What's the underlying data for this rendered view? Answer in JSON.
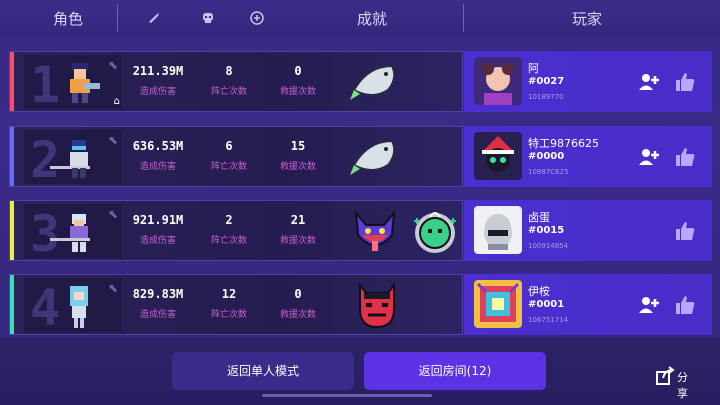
{
  "header": {
    "role": "角色",
    "achievement": "成就",
    "player": "玩家"
  },
  "rows": [
    {
      "rank": "1",
      "damage": "211.39M",
      "deaths": "8",
      "rescues": "0",
      "player": {
        "name": "阿",
        "tag": "#0027",
        "id": "10189770"
      }
    },
    {
      "rank": "2",
      "damage": "636.53M",
      "deaths": "6",
      "rescues": "15",
      "player": {
        "name": "特工9876625",
        "tag": "#0000",
        "id": "10987C625"
      }
    },
    {
      "rank": "3",
      "damage": "921.91M",
      "deaths": "2",
      "rescues": "21",
      "player": {
        "name": "卤蛋",
        "tag": "#0015",
        "id": "100914854"
      }
    },
    {
      "rank": "4",
      "damage": "829.83M",
      "deaths": "12",
      "rescues": "0",
      "player": {
        "name": "伊桉",
        "tag": "#0001",
        "id": "106751714"
      }
    }
  ],
  "labels": {
    "damage": "造成伤害",
    "deaths": "阵亡次数",
    "rescues": "救援次数"
  },
  "buttons": {
    "single": "返回单人模式",
    "room": "返回房间(12)",
    "share": "分享"
  },
  "colors": {
    "rank1": "#ff4a6a",
    "rank2": "#6a6aff",
    "rank3": "#e6f040",
    "rank4": "#36e0b8"
  }
}
